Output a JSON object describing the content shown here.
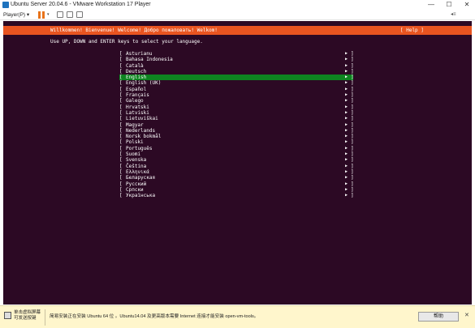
{
  "window": {
    "title": "Ubuntu Server 20.04.6 - VMware Workstation 17 Player",
    "minimize": "—",
    "maximize": "☐",
    "close": "✕"
  },
  "toolbar": {
    "player_menu": "Player(P) ▾",
    "pause_caret": "▾",
    "right_icon_label": "◂≡"
  },
  "installer": {
    "header_title": "Willkommen! Bienvenue! Welcome! Добро пожаловать! Welkom!",
    "help_label": "[ Help ]",
    "instruction": "Use UP, DOWN and ENTER keys to select your language.",
    "left_bracket": "[",
    "right_bracket": "]",
    "arrow": "▶",
    "selected_language": "English",
    "languages": [
      "Asturianu",
      "Bahasa Indonesia",
      "Català",
      "Deutsch",
      "English",
      "English (UK)",
      "Español",
      "Français",
      "Galego",
      "Hrvatski",
      "Latviski",
      "Lietuviškai",
      "Magyar",
      "Nederlands",
      "Norsk bokmål",
      "Polski",
      "Português",
      "Suomi",
      "Svenska",
      "Čeština",
      "Ελληνικά",
      "Беларуская",
      "Русский",
      "Српски",
      "Українська"
    ]
  },
  "notification": {
    "click_hint_line1": "单击虚拟屏幕",
    "click_hint_line2": "可发送按键",
    "message": "简易安装正在安装 Ubuntu 64 位 。Ubuntu14.04 及更高版本需要 Internet 连接才能安装 open-vm-tools。",
    "help_button": "帮助",
    "close": "✕"
  },
  "colors": {
    "console_bg": "#2c0924",
    "header_orange": "#e95420",
    "selection_green": "#0e8420",
    "notification_bg": "#fff6cc"
  }
}
